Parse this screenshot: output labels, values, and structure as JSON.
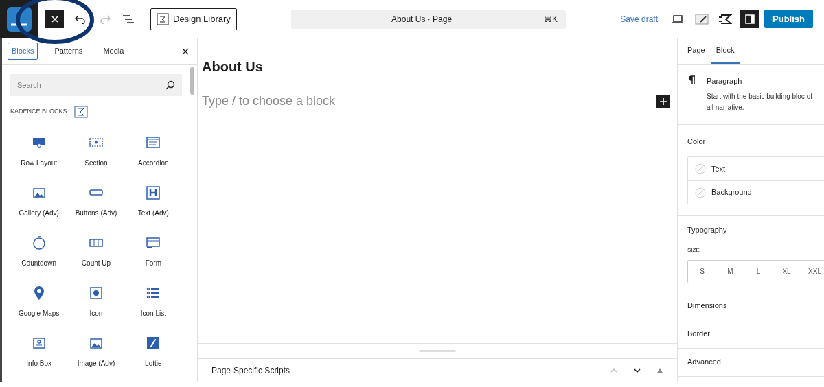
{
  "toolbar": {
    "close_selected": true,
    "design_library": "Design Library",
    "command": {
      "title": "About Us · Page",
      "shortcut": "⌘K"
    },
    "save_draft": "Save draft",
    "settings_on": true,
    "publish": "Publish"
  },
  "inserter": {
    "tabs": [
      {
        "label": "Blocks",
        "selected": true
      },
      {
        "label": "Patterns",
        "selected": false
      },
      {
        "label": "Media",
        "selected": false
      }
    ],
    "search": {
      "placeholder": "Search"
    },
    "category": "KADENCE BLOCKS",
    "blocks": [
      {
        "label": "Row Layout",
        "kind": "row"
      },
      {
        "label": "Section",
        "kind": "section"
      },
      {
        "label": "Accordion",
        "kind": "accordion"
      },
      {
        "label": "Gallery (Adv)",
        "kind": "gallery"
      },
      {
        "label": "Buttons (Adv)",
        "kind": "buttons"
      },
      {
        "label": "Text (Adv)",
        "kind": "heading"
      },
      {
        "label": "Countdown",
        "kind": "countdown"
      },
      {
        "label": "Count Up",
        "kind": "countup"
      },
      {
        "label": "Form",
        "kind": "form"
      },
      {
        "label": "Google Maps",
        "kind": "map"
      },
      {
        "label": "Icon",
        "kind": "icon"
      },
      {
        "label": "Icon List",
        "kind": "list"
      },
      {
        "label": "Info Box",
        "kind": "infobox"
      },
      {
        "label": "Image (Adv)",
        "kind": "image"
      },
      {
        "label": "Lottie",
        "kind": "lottie"
      }
    ]
  },
  "canvas": {
    "title": "About Us",
    "placeholder": "Type / to choose a block",
    "meta_box": "Page-Specific Scripts"
  },
  "sidebar": {
    "tabs": [
      {
        "label": "Page",
        "selected": false
      },
      {
        "label": "Block",
        "selected": true
      }
    ],
    "block": {
      "name": "Paragraph",
      "description": "Start with the basic building bloc of all narrative."
    },
    "color": {
      "title": "Color",
      "items": [
        "Text",
        "Background"
      ]
    },
    "typography": {
      "title": "Typography",
      "size_label": "SIZE",
      "sizes": [
        "S",
        "M",
        "L",
        "XL",
        "XXL"
      ]
    },
    "panels": [
      "Dimensions",
      "Border",
      "Advanced"
    ]
  }
}
